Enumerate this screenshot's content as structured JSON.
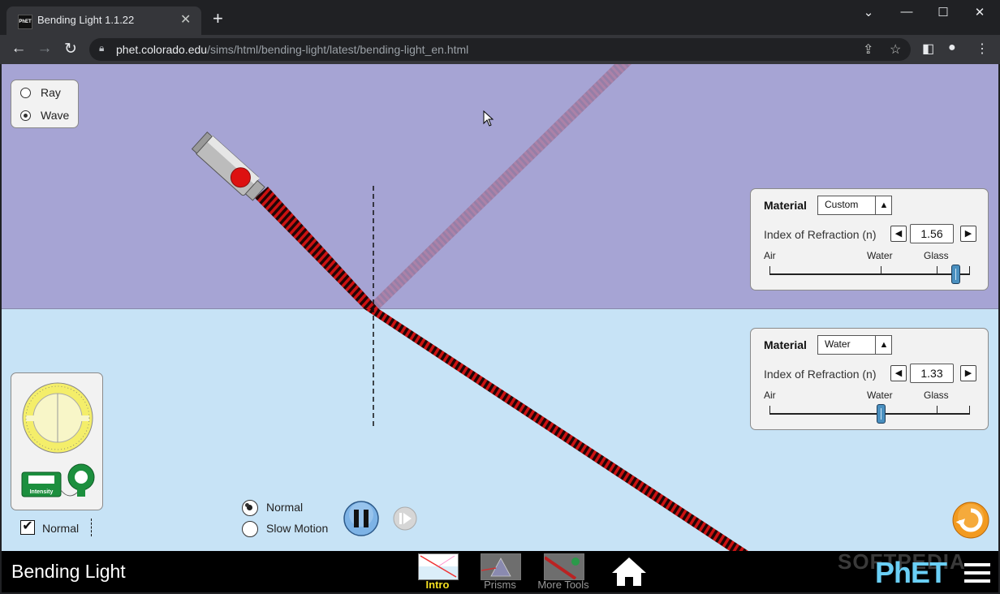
{
  "browser": {
    "tab_title": "Bending Light 1.1.22",
    "favicon_text": "PhET",
    "tab_close": "✕",
    "new_tab": "+",
    "url_host": "phet.colorado.edu",
    "url_path": "/sims/html/bending-light/latest/bending-light_en.html"
  },
  "sim": {
    "mode": {
      "options": [
        "Ray",
        "Wave"
      ],
      "selected": "Wave"
    },
    "top_material": {
      "title": "Material",
      "material": "Custom",
      "ior_label": "Index of Refraction (n)",
      "ior_value": "1.56",
      "ticks": [
        "Air",
        "Water",
        "Glass"
      ],
      "slider_fraction": 0.93
    },
    "bottom_material": {
      "title": "Material",
      "material": "Water",
      "ior_label": "Index of Refraction (n)",
      "ior_value": "1.33",
      "ticks": [
        "Air",
        "Water",
        "Glass"
      ],
      "slider_fraction": 0.55
    },
    "normal_checkbox": {
      "label": "Normal",
      "checked": true
    },
    "intensity_meter_label": "Intensity",
    "time_speed": {
      "options": [
        "Normal",
        "Slow Motion"
      ],
      "selected": "Normal"
    },
    "colors": {
      "air": "#a6a4d4",
      "water": "#c7e3f6",
      "beam": "#cc1111",
      "reset": "#f29a1f"
    }
  },
  "navbar": {
    "title": "Bending Light",
    "screens": [
      {
        "label": "Intro",
        "active": true
      },
      {
        "label": "Prisms",
        "active": false
      },
      {
        "label": "More Tools",
        "active": false
      }
    ],
    "brand": "PhET",
    "watermark": "SOFTPEDIA"
  }
}
